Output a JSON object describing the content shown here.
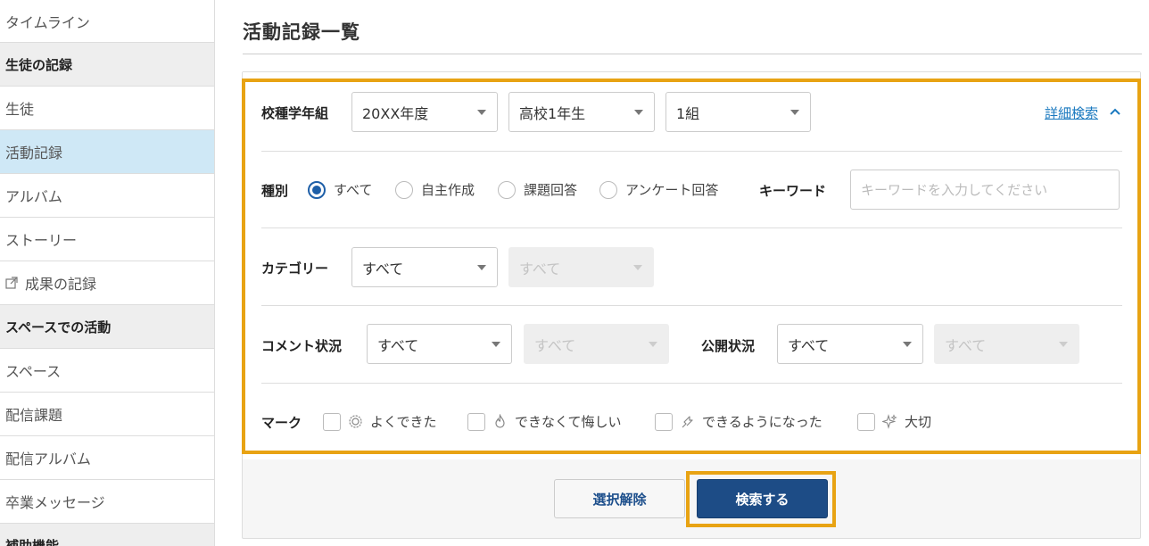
{
  "sidebar": {
    "items": [
      {
        "label": "タイムライン"
      },
      {
        "label": "生徒の記録"
      },
      {
        "label": "生徒"
      },
      {
        "label": "活動記録"
      },
      {
        "label": "アルバム"
      },
      {
        "label": "ストーリー"
      },
      {
        "label": "成果の記録"
      },
      {
        "label": "スペースでの活動"
      },
      {
        "label": "スペース"
      },
      {
        "label": "配信課題"
      },
      {
        "label": "配信アルバム"
      },
      {
        "label": "卒業メッセージ"
      },
      {
        "label": "補助機能"
      }
    ]
  },
  "page": {
    "title": "活動記録一覧"
  },
  "filters": {
    "school_grade_class": {
      "label": "校種学年組",
      "year": "20XX年度",
      "grade": "高校1年生",
      "class": "1組"
    },
    "advanced_search_link": "詳細検索",
    "type": {
      "label": "種別",
      "options": [
        "すべて",
        "自主作成",
        "課題回答",
        "アンケート回答"
      ],
      "selected": "すべて"
    },
    "keyword": {
      "label": "キーワード",
      "value": "",
      "placeholder": "キーワードを入力してください"
    },
    "category": {
      "label": "カテゴリー",
      "primary": "すべて",
      "secondary": "すべて"
    },
    "comment_status": {
      "label": "コメント状況",
      "primary": "すべて",
      "secondary": "すべて"
    },
    "publish_status": {
      "label": "公開状況",
      "primary": "すべて",
      "secondary": "すべて"
    },
    "mark": {
      "label": "マーク",
      "options": [
        {
          "label": "よくできた",
          "icon": "gear-badge-icon"
        },
        {
          "label": "できなくて悔しい",
          "icon": "flame-icon"
        },
        {
          "label": "できるようになった",
          "icon": "arrow-up-icon"
        },
        {
          "label": "大切",
          "icon": "sparkle-icon"
        }
      ]
    }
  },
  "actions": {
    "clear_label": "選択解除",
    "search_label": "検索する"
  },
  "colors": {
    "accent_highlight": "#e8a313",
    "primary_button": "#1d4c86",
    "active_nav": "#cfe8f6",
    "link": "#1a79bf"
  }
}
